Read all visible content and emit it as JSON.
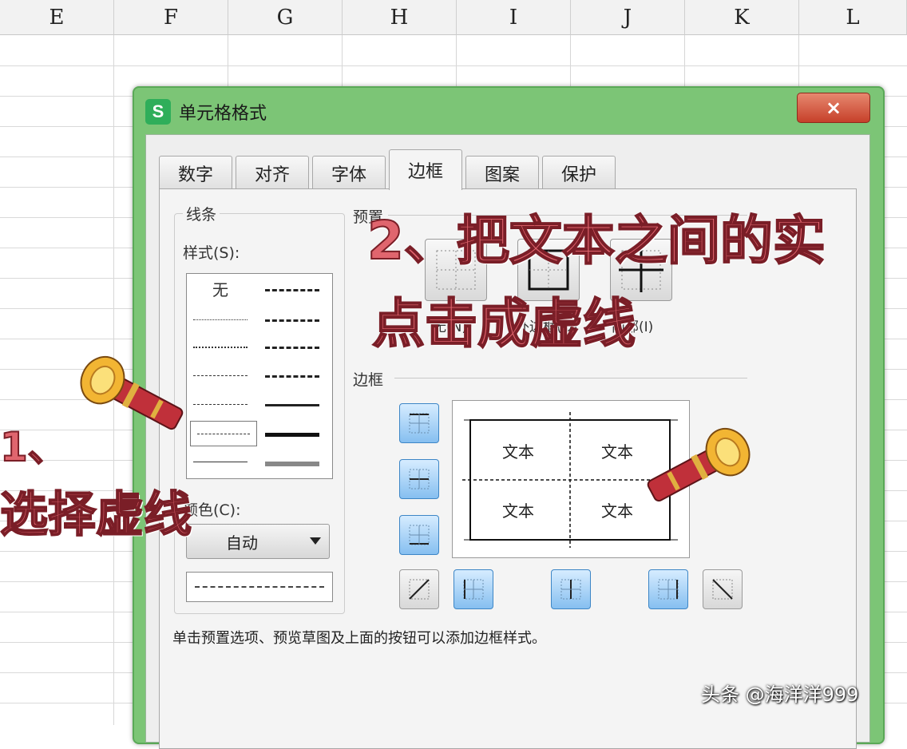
{
  "spreadsheet": {
    "columns": [
      "E",
      "F",
      "G",
      "H",
      "I",
      "J",
      "K",
      "L"
    ]
  },
  "dialog": {
    "title": "单元格格式",
    "logo_letter": "S",
    "close_label": "×",
    "tabs": [
      {
        "label": "数字",
        "active": false
      },
      {
        "label": "对齐",
        "active": false
      },
      {
        "label": "字体",
        "active": false
      },
      {
        "label": "边框",
        "active": true
      },
      {
        "label": "图案",
        "active": false
      },
      {
        "label": "保护",
        "active": false
      }
    ],
    "line": {
      "group_label": "线条",
      "style_label": "样式(S):",
      "style_none": "无",
      "color_label": "颜色(C):",
      "color_value": "自动"
    },
    "presets": {
      "label": "预置",
      "items": [
        "无(N)",
        "外边框(O)",
        "内部(I)"
      ]
    },
    "border": {
      "label": "边框",
      "cell_text": "文本"
    },
    "hint": "单击预置选项、预览草图及上面的按钮可以添加边框样式。"
  },
  "annotations": {
    "step1_line1": "1、",
    "step1_line2": "选择虚线",
    "step2_line1": "2、把文本之间的实",
    "step2_line2": "点击成虚线"
  },
  "watermark": "头条 @海洋洋999",
  "colors": {
    "dialog_frame": "#7cc576",
    "annotation_fill": "#e0656e",
    "annotation_stroke": "#7a1e27",
    "border_button_blue": "#86bff0"
  },
  "icons": [
    "app-logo-icon",
    "close-icon",
    "dropdown-arrow-icon",
    "telescope-icon"
  ]
}
